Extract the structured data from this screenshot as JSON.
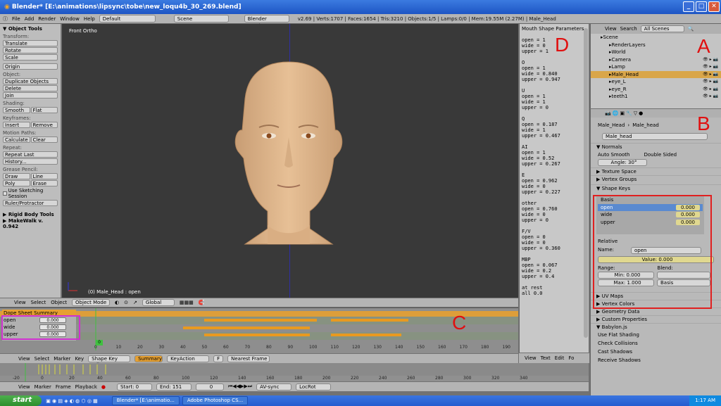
{
  "window": {
    "title": "Blender* [E:\\animations\\lipsync\\tobe\\new_loqu4b_30_269.blend]",
    "min": "_",
    "max": "□",
    "close": "✕"
  },
  "topbar": {
    "menus": [
      "File",
      "Add",
      "Render",
      "Window",
      "Help"
    ],
    "layout": "Default",
    "scene": "Scene",
    "engine": "Blender Render",
    "stats": "v2.69 | Verts:1707 | Faces:1654 | Tris:3210 | Objects:1/5 | Lamps:0/0 | Mem:19.55M (2.27M) | Male_Head"
  },
  "tools": {
    "header": "▼ Object Tools",
    "transform_label": "Transform:",
    "transform": [
      "Translate",
      "Rotate",
      "Scale"
    ],
    "origin": "Origin",
    "object_label": "Object:",
    "object": [
      "Duplicate Objects",
      "Delete",
      "Join"
    ],
    "shading_label": "Shading:",
    "shading": [
      "Smooth",
      "Flat"
    ],
    "keyframes_label": "Keyframes:",
    "keyframes": [
      "Insert",
      "Remove"
    ],
    "motion_label": "Motion Paths:",
    "motion": [
      "Calculate",
      "Clear"
    ],
    "repeat_label": "Repeat:",
    "repeat": [
      "Repeat Last",
      "History..."
    ],
    "grease_label": "Grease Pencil:",
    "grease1": [
      "Draw",
      "Line"
    ],
    "grease2": [
      "Poly",
      "Erase"
    ],
    "sketch": "Use Sketching Session",
    "ruler": "Ruler/Protractor",
    "rigid": "▶ Rigid Body Tools",
    "more": "▶ MakeWalk v. 0.942"
  },
  "viewport": {
    "view_label": "Front Ortho",
    "object_label": "(0) Male_Head : open",
    "header_items": [
      "View",
      "Select",
      "Object"
    ],
    "mode": "Object Mode",
    "orientation": "Global"
  },
  "text_panel": {
    "title": "Mouth Shape Parameters",
    "body": "\nopen = 1\nwide = 0\nupper = 1\n\nO\nopen = 1\nwide = 0.840\nupper = 0.947\n\nU\nopen = 1\nwide = 1\nupper = 0\n\nQ\nopen = 0.187\nwide = 1\nupper = 0.467\n\nAI\nopen = 1\nwide = 0.52\nupper = 0.267\n\nE\nopen = 0.962\nwide = 0\nupper = 0.227\n\nother\nopen = 0.760\nwide = 0\nupper = 0\n\nF/V\nopen = 0\nwide = 0\nupper = 0.360\n\nMBP\nopen = 0.067\nwide = 0.2\nupper = 0.4\n\nat rest\nall 0.0",
    "footer": [
      "View",
      "Text",
      "Edit",
      "Fo"
    ]
  },
  "outliner": {
    "header": [
      "View",
      "Search"
    ],
    "filter": "All Scenes",
    "items": [
      {
        "label": "Scene",
        "indent": 0,
        "selected": false
      },
      {
        "label": "RenderLayers",
        "indent": 1,
        "selected": false
      },
      {
        "label": "World",
        "indent": 1,
        "selected": false
      },
      {
        "label": "Camera",
        "indent": 1,
        "selected": false
      },
      {
        "label": "Lamp",
        "indent": 1,
        "selected": false
      },
      {
        "label": "Male_Head",
        "indent": 1,
        "selected": true
      },
      {
        "label": "eye_L",
        "indent": 1,
        "selected": false
      },
      {
        "label": "eye_R",
        "indent": 1,
        "selected": false
      },
      {
        "label": "teeth1",
        "indent": 1,
        "selected": false
      }
    ]
  },
  "props": {
    "breadcrumb": [
      "Male_Head",
      "Male_head"
    ],
    "mesh_name": "Male_head",
    "normals": "▼ Normals",
    "auto_smooth": "Auto Smooth",
    "double_sided": "Double Sided",
    "angle": "Angle: 30°",
    "texture_space": "▶ Texture Space",
    "vertex_groups": "▶ Vertex Groups",
    "shape_keys": "▼ Shape Keys",
    "keys": [
      {
        "name": "Basis",
        "value": ""
      },
      {
        "name": "open",
        "value": "0.000"
      },
      {
        "name": "wide",
        "value": "0.000"
      },
      {
        "name": "upper",
        "value": "0.000"
      }
    ],
    "relative": "Relative",
    "name_label": "Name:",
    "name_value": "open",
    "value_field": "Value: 0.000",
    "range_label": "Range:",
    "blend_label": "Blend:",
    "min": "Min: 0.000",
    "max": "Max: 1.000",
    "blend_value": "Basis",
    "uv_maps": "▶ UV Maps",
    "vertex_colors": "▶ Vertex Colors",
    "geometry_data": "▶ Geometry Data",
    "custom_props": "▶ Custom Properties",
    "babylon": "▼ Babylon.js",
    "babylon_opts": [
      "Use Flat Shading",
      "Check Collisions",
      "Cast Shadows",
      "Receive Shadows"
    ]
  },
  "dope": {
    "summary": "Dope Sheet Summary",
    "channels": [
      {
        "name": "open",
        "value": "0.000"
      },
      {
        "name": "wide",
        "value": "0.000"
      },
      {
        "name": "upper",
        "value": "0.000"
      }
    ],
    "ruler": [
      "0",
      "10",
      "20",
      "30",
      "40",
      "50",
      "60",
      "70",
      "80",
      "90",
      "100",
      "110",
      "120",
      "130",
      "140",
      "150",
      "160",
      "170",
      "180",
      "190"
    ],
    "current_frame": "0",
    "menu": [
      "View",
      "Select",
      "Marker",
      "Key"
    ],
    "mode": "Shape Key Edito",
    "summary_btn": "Summary",
    "action": "KeyAction",
    "f_btn": "F",
    "snap": "Nearest Frame"
  },
  "timeline": {
    "ruler": [
      "-20",
      "0",
      "20",
      "40",
      "60",
      "80",
      "100",
      "120",
      "140",
      "160",
      "180",
      "200",
      "220",
      "240",
      "260",
      "280",
      "300",
      "320",
      "340"
    ],
    "menu": [
      "View",
      "Marker",
      "Frame",
      "Playback"
    ],
    "start": "Start: 0",
    "end": "End: 151",
    "frame": "0",
    "sync": "AV-sync",
    "keying": "LocRot"
  },
  "annotations": {
    "a": "A",
    "b": "B",
    "c": "C",
    "d": "D"
  },
  "taskbar": {
    "start": "start",
    "tasks": [
      "Blender* [E:\\animatio...",
      "Adobe Photoshop CS..."
    ],
    "time": "1:17 AM"
  }
}
